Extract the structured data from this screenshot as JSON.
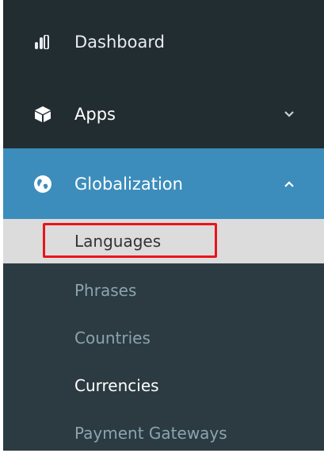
{
  "menu": {
    "dashboard": {
      "label": "Dashboard",
      "icon": "bar-chart-icon"
    },
    "apps": {
      "label": "Apps",
      "icon": "cube-icon",
      "chevron": "chevron-down-icon"
    },
    "globalization": {
      "label": "Globalization",
      "icon": "globe-icon",
      "chevron": "chevron-up-icon",
      "active_color": "#3c8dbc"
    }
  },
  "submenu": {
    "items": [
      {
        "label": "Languages",
        "selected": true
      },
      {
        "label": "Phrases"
      },
      {
        "label": "Countries"
      },
      {
        "label": "Currencies"
      },
      {
        "label": "Payment Gateways"
      }
    ]
  },
  "annotation": {
    "highlight_color": "#e8151b"
  }
}
